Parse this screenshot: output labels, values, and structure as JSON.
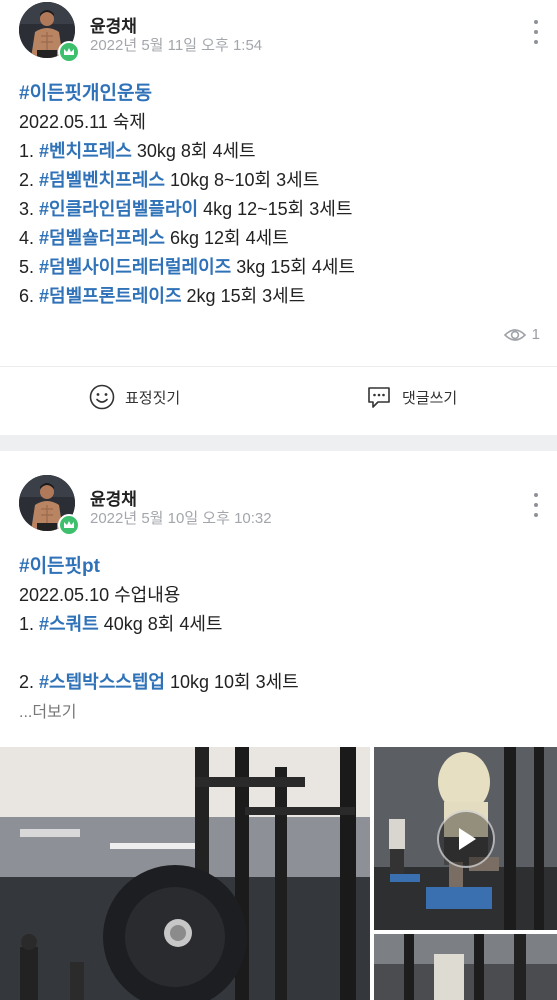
{
  "posts": [
    {
      "author": "윤경채",
      "date": "2022년 5월 11일 오후 1:54",
      "hashtag": "#이든핏개인운동",
      "subtitle": "2022.05.11 숙제",
      "lines": [
        {
          "num": "1.",
          "tag": "#벤치프레스",
          "rest": "30kg 8회 4세트"
        },
        {
          "num": "2.",
          "tag": "#덤벨벤치프레스",
          "rest": "10kg 8~10회 3세트"
        },
        {
          "num": "3.",
          "tag": "#인클라인덤벨플라이",
          "rest": "4kg 12~15회 3세트"
        },
        {
          "num": "4.",
          "tag": "#덤벨숄더프레스",
          "rest": "6kg 12회 4세트"
        },
        {
          "num": "5.",
          "tag": "#덤벨사이드레터럴레이즈",
          "rest": "3kg 15회 4세트"
        },
        {
          "num": "6.",
          "tag": "#덤벨프론트레이즈",
          "rest": "2kg 15회 3세트"
        }
      ],
      "view_count": "1",
      "actions": {
        "emotion": "표정짓기",
        "comment": "댓글쓰기"
      }
    },
    {
      "author": "윤경채",
      "date": "2022년 5월 10일 오후 10:32",
      "hashtag": "#이든핏pt",
      "subtitle": "2022.05.10 수업내용",
      "lines": [
        {
          "num": "1.",
          "tag": "#스쿼트",
          "rest": "40kg 8회 4세트"
        },
        {
          "num": "2.",
          "tag": "#스텝박스스텝업",
          "rest": "10kg 10회 3세트"
        }
      ],
      "more_label": "...더보기"
    }
  ],
  "colors": {
    "hashtag": "#2f72b8",
    "badge": "#3dbf6e",
    "section_gap": "#eeeff1"
  },
  "icons": {
    "crown": "crown-icon",
    "more": "more-vertical-icon",
    "views": "eye-icon",
    "emotion": "smile-icon",
    "comment": "comment-icon",
    "play": "play-icon"
  }
}
